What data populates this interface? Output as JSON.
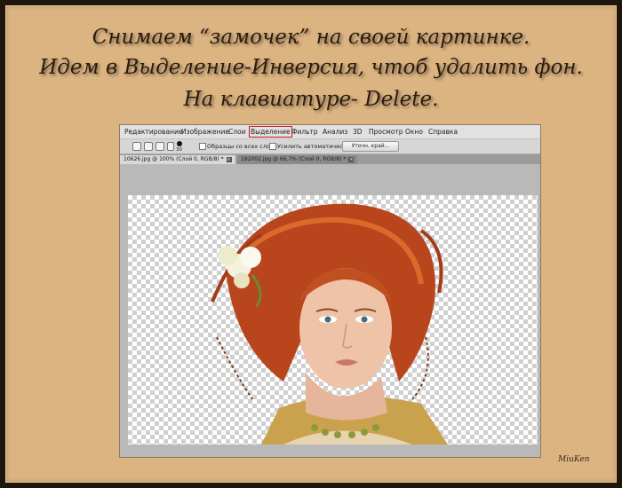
{
  "instructions": {
    "line1": "Снимаем “замочек” на своей картинке.",
    "line2": "Идем в Выделение-Инверсия, чтоб удалить фон.",
    "line3": "На клавиатуре- Delete."
  },
  "menubar": {
    "items": [
      "Редактирование",
      "Изображение",
      "Слои",
      "Выделение",
      "Фильтр",
      "Анализ",
      "3D",
      "Просмотр",
      "Окно",
      "Справка"
    ],
    "highlighted": "Выделение"
  },
  "options": {
    "brush_size": "30",
    "sample_all_layers": "Образцы со всех слоев",
    "auto_enhance": "Усилить автоматически",
    "refine_edge": "Уточн. край..."
  },
  "tabs": [
    {
      "label": "10626.jpg @ 100% (Слой 0, RGB/8) *",
      "close": "×"
    },
    {
      "label": "182002.jpg @ 66,7% (Слой 0, RGB/8) *",
      "close": "×"
    }
  ],
  "signature": "MiuKen",
  "colors": {
    "highlight": "#d01818",
    "background": "#dcb482",
    "hair": "#b8451b"
  }
}
